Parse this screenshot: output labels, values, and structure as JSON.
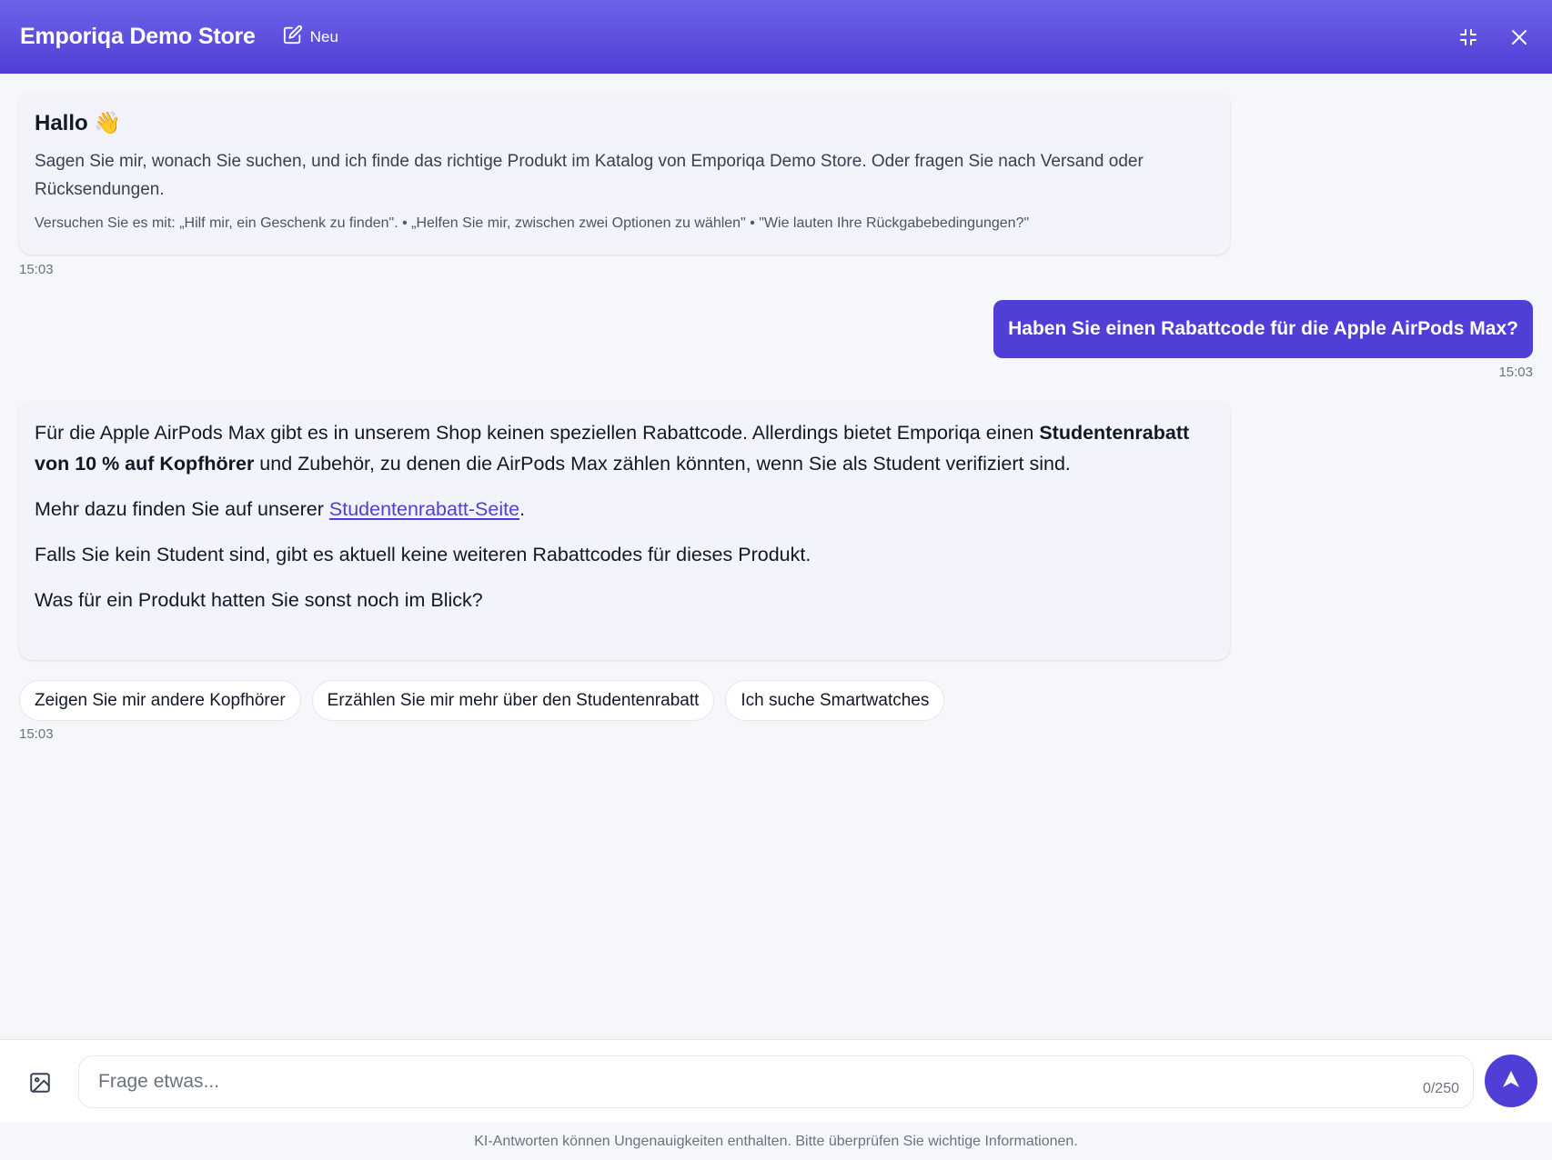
{
  "header": {
    "store_name": "Emporiqa Demo Store",
    "new_label": "Neu"
  },
  "welcome": {
    "greeting": "Hallo 👋",
    "intro": "Sagen Sie mir, wonach Sie suchen, und ich finde das richtige Produkt im Katalog von Emporiqa Demo Store. Oder fragen Sie nach Versand oder Rücksendungen.",
    "hints": "Versuchen Sie es mit: „Hilf mir, ein Geschenk zu finden\". • „Helfen Sie mir, zwischen zwei Optionen zu wählen\" • \"Wie lauten Ihre Rückgabebedingungen?\"",
    "time": "15:03"
  },
  "user_message": {
    "text": "Haben Sie einen Rabattcode für die Apple AirPods Max?",
    "time": "15:03"
  },
  "reply": {
    "p1_start": "Für die Apple AirPods Max gibt es in unserem Shop keinen speziellen Rabattcode. Allerdings bietet Emporiqa einen ",
    "p1_bold": "Studentenrabatt von 10 % auf Kopfhörer",
    "p1_end": " und Zubehör, zu denen die AirPods Max zählen könnten, wenn Sie als Student verifiziert sind.",
    "p2_start": "Mehr dazu finden Sie auf unserer ",
    "p2_link": "Studentenrabatt-Seite",
    "p2_end": ".",
    "p3": "Falls Sie kein Student sind, gibt es aktuell keine weiteren Rabattcodes für dieses Produkt.",
    "p4": "Was für ein Produkt hatten Sie sonst noch im Blick?",
    "time": "15:03"
  },
  "suggestions": [
    "Zeigen Sie mir andere Kopfhörer",
    "Erzählen Sie mir mehr über den Studentenrabatt",
    "Ich suche Smartwatches"
  ],
  "composer": {
    "placeholder": "Frage etwas...",
    "value": "",
    "counter": "0/250"
  },
  "disclaimer": "KI-Antworten können Ungenauigkeiten enthalten. Bitte überprüfen Sie wichtige Informationen.",
  "icons": {
    "new": "edit-icon",
    "collapse": "minimize-icon",
    "close": "close-icon",
    "image": "image-icon",
    "send": "send-icon"
  },
  "colors": {
    "accent": "#4f3fd6",
    "header_gradient_top": "#6c63e8",
    "bubble_bg": "#f3f3fb"
  }
}
